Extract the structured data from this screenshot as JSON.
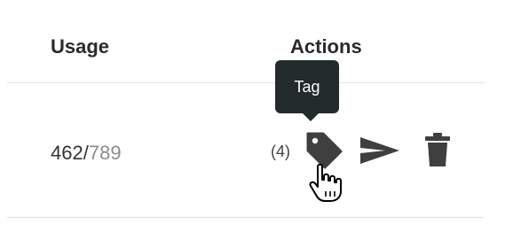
{
  "table": {
    "headers": {
      "usage": "Usage",
      "actions": "Actions"
    },
    "row": {
      "usage_used": "462",
      "usage_separator": "/",
      "usage_limit": "789",
      "tag_count": "(4)",
      "actions": {
        "tag_icon": "tag-icon",
        "send_icon": "send-icon",
        "trash_icon": "trash-icon"
      }
    }
  },
  "tooltip": {
    "text": "Tag"
  },
  "colors": {
    "icon": "#3f3f3f",
    "tooltip_bg": "#232b2b",
    "muted_text": "#8c8c8c"
  }
}
